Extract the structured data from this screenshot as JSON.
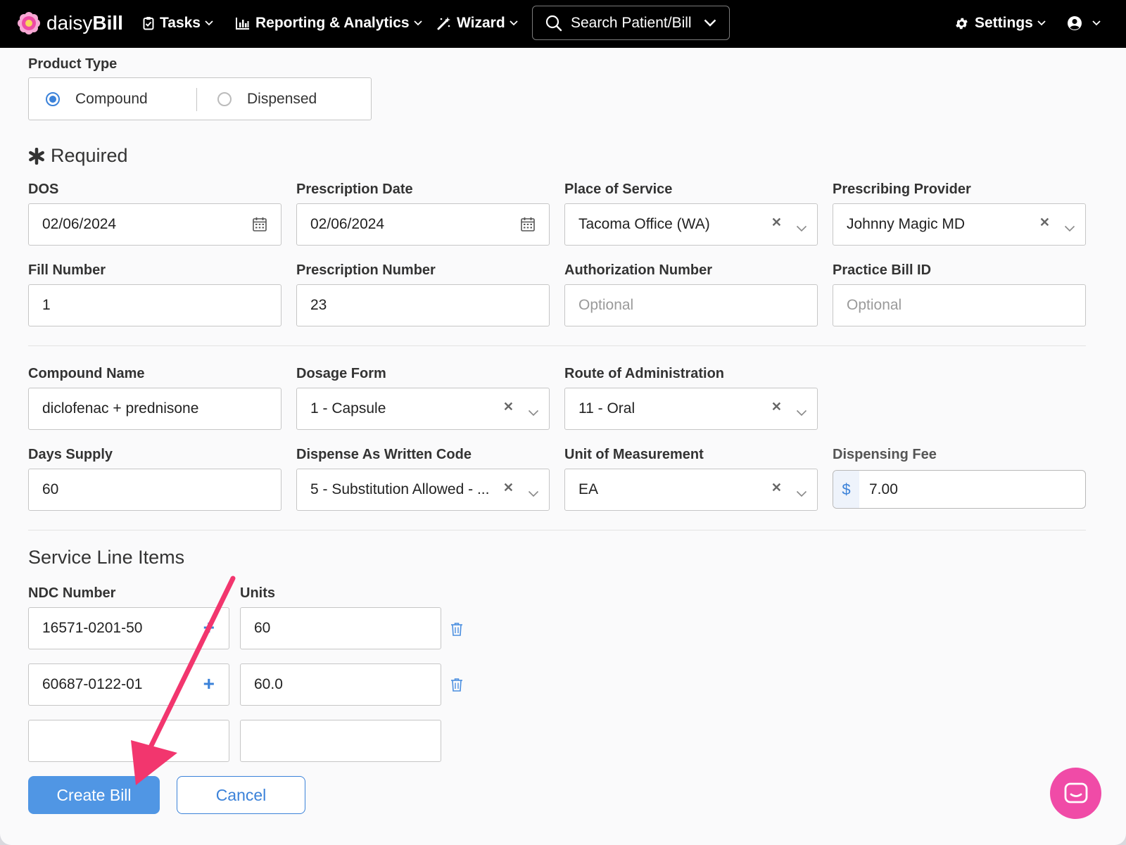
{
  "nav": {
    "brand_light": "daisy",
    "brand_bold": "Bill",
    "tasks": "Tasks",
    "reporting": "Reporting & Analytics",
    "wizard": "Wizard",
    "search": "Search Patient/Bill",
    "settings": "Settings"
  },
  "product_type": {
    "label": "Product Type",
    "options": [
      "Compound",
      "Dispensed"
    ],
    "selected": "Compound"
  },
  "required_title": "Required",
  "fields": {
    "dos": {
      "label": "DOS",
      "value": "02/06/2024"
    },
    "prescription_date": {
      "label": "Prescription Date",
      "value": "02/06/2024"
    },
    "place_of_service": {
      "label": "Place of Service",
      "value": "Tacoma Office (WA)"
    },
    "prescribing_provider": {
      "label": "Prescribing Provider",
      "value": "Johnny Magic MD"
    },
    "fill_number": {
      "label": "Fill Number",
      "value": "1"
    },
    "prescription_number": {
      "label": "Prescription Number",
      "value": "23"
    },
    "authorization_number": {
      "label": "Authorization Number",
      "placeholder": "Optional"
    },
    "practice_bill_id": {
      "label": "Practice Bill ID",
      "placeholder": "Optional"
    },
    "compound_name": {
      "label": "Compound Name",
      "value": "diclofenac + prednisone"
    },
    "dosage_form": {
      "label": "Dosage Form",
      "value": "1 - Capsule"
    },
    "route": {
      "label": "Route of Administration",
      "value": "11 - Oral"
    },
    "days_supply": {
      "label": "Days Supply",
      "value": "60"
    },
    "daw_code": {
      "label": "Dispense As Written Code",
      "value": "5 - Substitution Allowed - ..."
    },
    "unit_of_measurement": {
      "label": "Unit of Measurement",
      "value": "EA"
    },
    "dispensing_fee": {
      "label": "Dispensing Fee",
      "currency": "$",
      "value": "7.00"
    }
  },
  "service_lines": {
    "title": "Service Line Items",
    "col_ndc": "NDC Number",
    "col_units": "Units",
    "rows": [
      {
        "ndc": "16571-0201-50",
        "units": "60"
      },
      {
        "ndc": "60687-0122-01",
        "units": "60.0"
      },
      {
        "ndc": "",
        "units": ""
      }
    ]
  },
  "buttons": {
    "create": "Create Bill",
    "cancel": "Cancel"
  },
  "colors": {
    "accent": "#3b82d9",
    "primary_button": "#5096e4",
    "chat_bubble": "#f04ba7",
    "annotation_arrow": "#f2366e"
  }
}
